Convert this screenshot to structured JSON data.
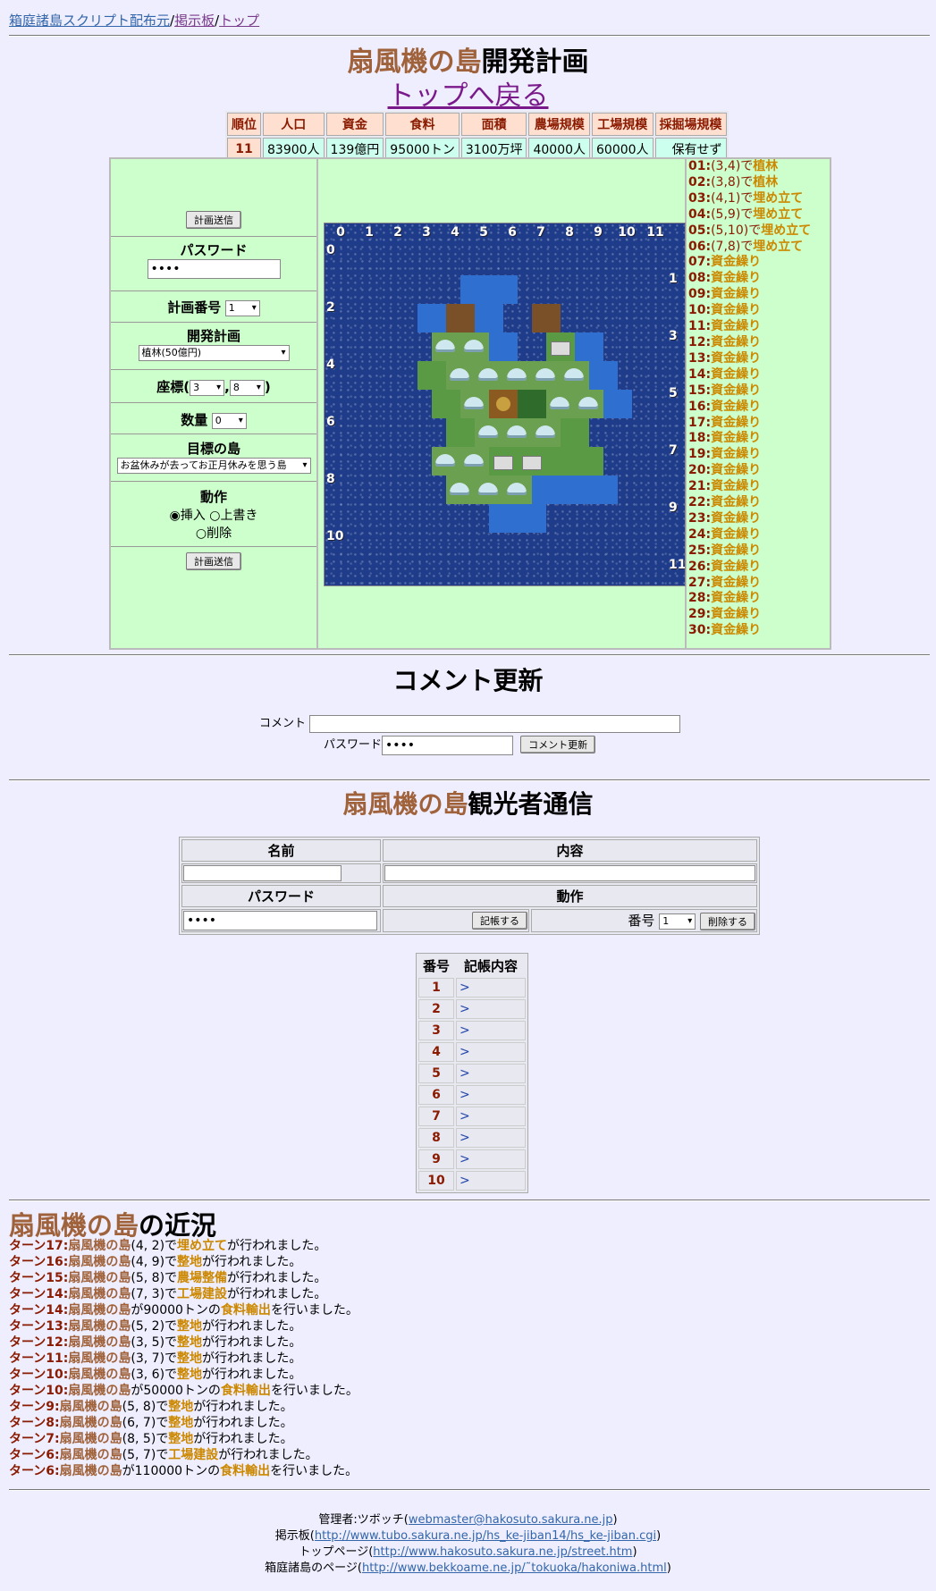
{
  "nav": {
    "link1": "箱庭諸島スクリプト配布元",
    "sep1": "/",
    "link2": "掲示板",
    "sep2": "/",
    "link3": "トップ"
  },
  "header": {
    "island": "扇風機の島",
    "title_suffix": "開発計画",
    "back": "トップへ戻る"
  },
  "stats": {
    "headers": [
      "順位",
      "人口",
      "資金",
      "食料",
      "面積",
      "農場規模",
      "工場規模",
      "採掘場規模"
    ],
    "values": [
      "11",
      "83900人",
      "139億円",
      "95000トン",
      "3100万坪",
      "40000人",
      "60000人",
      "保有せず"
    ]
  },
  "form": {
    "send_button": "計画送信",
    "password_label": "パスワード",
    "password_value": "••••",
    "plan_no_label": "計画番号",
    "plan_no_value": "1",
    "dev_label": "開発計画",
    "dev_value": "植林(50億円)",
    "coord_label": "座標(",
    "coord_x": "3",
    "coord_sep": ",",
    "coord_y": "8",
    "coord_close": ")",
    "qty_label": "数量",
    "qty_value": "0",
    "target_label": "目標の島",
    "target_value": "お盆休みが去ってお正月休みを思う島",
    "action_label": "動作",
    "action_insert": "挿入",
    "action_overwrite": "上書き",
    "action_delete": "削除"
  },
  "map": {
    "cols": [
      "0",
      "1",
      "2",
      "3",
      "4",
      "5",
      "6",
      "7",
      "8",
      "9",
      "10",
      "11"
    ],
    "rows": [
      "0",
      "1",
      "2",
      "3",
      "4",
      "5",
      "6",
      "7",
      "8",
      "9",
      "10",
      "11"
    ]
  },
  "plans": [
    {
      "no": "01",
      "pos": "(3,4)",
      "mid": "で",
      "act": "植林"
    },
    {
      "no": "02",
      "pos": "(3,8)",
      "mid": "で",
      "act": "植林"
    },
    {
      "no": "03",
      "pos": "(4,1)",
      "mid": "で",
      "act": "埋め立て"
    },
    {
      "no": "04",
      "pos": "(5,9)",
      "mid": "で",
      "act": "埋め立て"
    },
    {
      "no": "05",
      "pos": "(5,10)",
      "mid": "で",
      "act": "埋め立て"
    },
    {
      "no": "06",
      "pos": "(7,8)",
      "mid": "で",
      "act": "埋め立て"
    },
    {
      "no": "07",
      "pos": "",
      "mid": "",
      "act": "資金繰り"
    },
    {
      "no": "08",
      "pos": "",
      "mid": "",
      "act": "資金繰り"
    },
    {
      "no": "09",
      "pos": "",
      "mid": "",
      "act": "資金繰り"
    },
    {
      "no": "10",
      "pos": "",
      "mid": "",
      "act": "資金繰り"
    },
    {
      "no": "11",
      "pos": "",
      "mid": "",
      "act": "資金繰り"
    },
    {
      "no": "12",
      "pos": "",
      "mid": "",
      "act": "資金繰り"
    },
    {
      "no": "13",
      "pos": "",
      "mid": "",
      "act": "資金繰り"
    },
    {
      "no": "14",
      "pos": "",
      "mid": "",
      "act": "資金繰り"
    },
    {
      "no": "15",
      "pos": "",
      "mid": "",
      "act": "資金繰り"
    },
    {
      "no": "16",
      "pos": "",
      "mid": "",
      "act": "資金繰り"
    },
    {
      "no": "17",
      "pos": "",
      "mid": "",
      "act": "資金繰り"
    },
    {
      "no": "18",
      "pos": "",
      "mid": "",
      "act": "資金繰り"
    },
    {
      "no": "19",
      "pos": "",
      "mid": "",
      "act": "資金繰り"
    },
    {
      "no": "20",
      "pos": "",
      "mid": "",
      "act": "資金繰り"
    },
    {
      "no": "21",
      "pos": "",
      "mid": "",
      "act": "資金繰り"
    },
    {
      "no": "22",
      "pos": "",
      "mid": "",
      "act": "資金繰り"
    },
    {
      "no": "23",
      "pos": "",
      "mid": "",
      "act": "資金繰り"
    },
    {
      "no": "24",
      "pos": "",
      "mid": "",
      "act": "資金繰り"
    },
    {
      "no": "25",
      "pos": "",
      "mid": "",
      "act": "資金繰り"
    },
    {
      "no": "26",
      "pos": "",
      "mid": "",
      "act": "資金繰り"
    },
    {
      "no": "27",
      "pos": "",
      "mid": "",
      "act": "資金繰り"
    },
    {
      "no": "28",
      "pos": "",
      "mid": "",
      "act": "資金繰り"
    },
    {
      "no": "29",
      "pos": "",
      "mid": "",
      "act": "資金繰り"
    },
    {
      "no": "30",
      "pos": "",
      "mid": "",
      "act": "資金繰り"
    }
  ],
  "comment": {
    "title": "コメント更新",
    "label": "コメント",
    "password_label": "パスワード",
    "password_value": "••••",
    "button": "コメント更新"
  },
  "bbs": {
    "title_suffix": "観光者通信",
    "name_header": "名前",
    "content_header": "内容",
    "password_header": "パスワード",
    "action_header": "動作",
    "password_value": "••••",
    "post_button": "記帳する",
    "number_label": "番号",
    "number_value": "1",
    "delete_button": "削除する"
  },
  "log": {
    "headers": [
      "番号",
      "記帳内容"
    ],
    "rows": [
      "1",
      "2",
      "3",
      "4",
      "5",
      "6",
      "7",
      "8",
      "9",
      "10"
    ],
    "marker": ">"
  },
  "recent": {
    "title_suffix": "の近況",
    "items": [
      {
        "turn": "ターン17:",
        "island": "扇風機の島",
        "detail": "(4, 2)で",
        "act": "埋め立て",
        "end": "が行われました。"
      },
      {
        "turn": "ターン16:",
        "island": "扇風機の島",
        "detail": "(4, 9)で",
        "act": "整地",
        "end": "が行われました。"
      },
      {
        "turn": "ターン15:",
        "island": "扇風機の島",
        "detail": "(5, 8)で",
        "act": "農場整備",
        "end": "が行われました。"
      },
      {
        "turn": "ターン14:",
        "island": "扇風機の島",
        "detail": "(7, 3)で",
        "act": "工場建設",
        "end": "が行われました。"
      },
      {
        "turn": "ターン14:",
        "island": "扇風機の島",
        "detail": "が90000トンの",
        "act": "食料輸出",
        "end": "を行いました。"
      },
      {
        "turn": "ターン13:",
        "island": "扇風機の島",
        "detail": "(5, 2)で",
        "act": "整地",
        "end": "が行われました。"
      },
      {
        "turn": "ターン12:",
        "island": "扇風機の島",
        "detail": "(3, 5)で",
        "act": "整地",
        "end": "が行われました。"
      },
      {
        "turn": "ターン11:",
        "island": "扇風機の島",
        "detail": "(3, 7)で",
        "act": "整地",
        "end": "が行われました。"
      },
      {
        "turn": "ターン10:",
        "island": "扇風機の島",
        "detail": "(3, 6)で",
        "act": "整地",
        "end": "が行われました。"
      },
      {
        "turn": "ターン10:",
        "island": "扇風機の島",
        "detail": "が50000トンの",
        "act": "食料輸出",
        "end": "を行いました。"
      },
      {
        "turn": "ターン9:",
        "island": "扇風機の島",
        "detail": "(5, 8)で",
        "act": "整地",
        "end": "が行われました。"
      },
      {
        "turn": "ターン8:",
        "island": "扇風機の島",
        "detail": "(6, 7)で",
        "act": "整地",
        "end": "が行われました。"
      },
      {
        "turn": "ターン7:",
        "island": "扇風機の島",
        "detail": "(8, 5)で",
        "act": "整地",
        "end": "が行われました。"
      },
      {
        "turn": "ターン6:",
        "island": "扇風機の島",
        "detail": "(5, 7)で",
        "act": "工場建設",
        "end": "が行われました。"
      },
      {
        "turn": "ターン6:",
        "island": "扇風機の島",
        "detail": "が110000トンの",
        "act": "食料輸出",
        "end": "を行いました。"
      }
    ]
  },
  "footer": {
    "admin_label": "管理者:ツボッチ(",
    "admin_email": "webmaster@hakosuto.sakura.ne.jp",
    "admin_close": ")",
    "bbs_label": "掲示板(",
    "bbs_url": "http://www.tubo.sakura.ne.jp/hs_ke-jiban14/hs_ke-jiban.cgi",
    "bbs_close": ")",
    "top_label": "トップページ(",
    "top_url": "http://www.hakosuto.sakura.ne.jp/street.htm",
    "top_close": ")",
    "hakoniwa_label": "箱庭諸島のページ(",
    "hakoniwa_url": "http://www.bekkoame.ne.jp/˜tokuoka/hakoniwa.html",
    "hakoniwa_close": ")"
  }
}
